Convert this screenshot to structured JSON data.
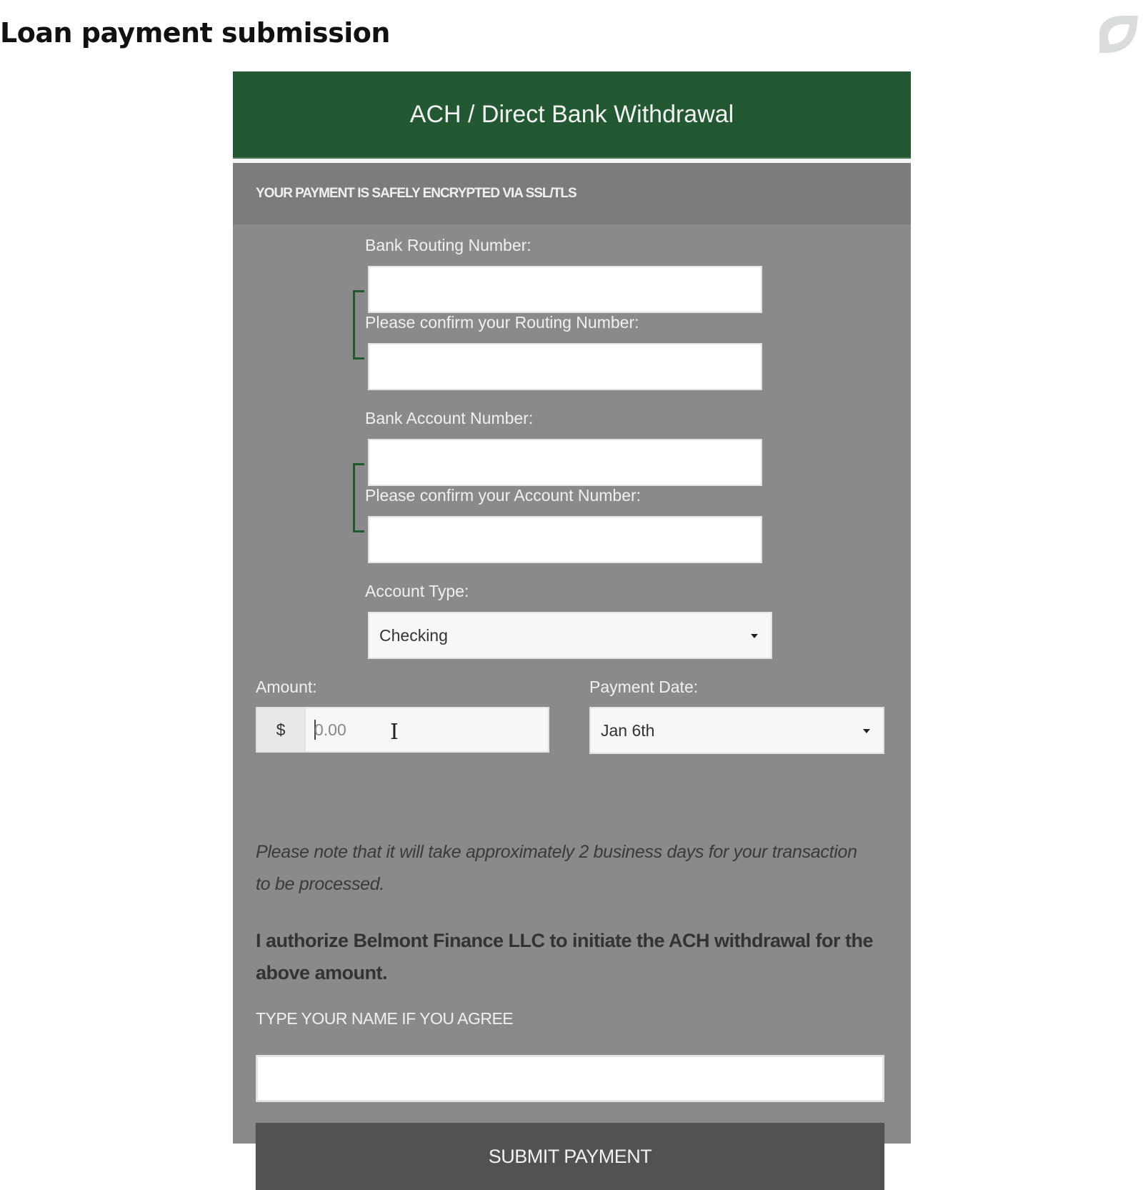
{
  "page": {
    "title": "Loan payment submission",
    "corner_icon": "leaf-logo-icon"
  },
  "form": {
    "header": "ACH / Direct Bank Withdrawal",
    "secure_banner": "YOUR PAYMENT IS SAFELY ENCRYPTED VIA SSL/TLS",
    "routing_label": "Bank Routing Number:",
    "routing_value": "",
    "confirm_routing_label": "Please confirm your Routing Number:",
    "confirm_routing_value": "",
    "account_label": "Bank Account Number:",
    "account_value": "",
    "confirm_account_label": "Please confirm your Account Number:",
    "confirm_account_value": "",
    "account_type_label": "Account Type:",
    "account_type_value": "Checking",
    "amount_label": "Amount:",
    "amount_prefix": "$",
    "amount_placeholder": "0.00",
    "payment_date_label": "Payment Date:",
    "payment_date_value": "Jan 6th",
    "processing_note": "Please note that it will take approximately 2 business days for your transaction to be processed.",
    "authorization_text": "I authorize Belmont Finance LLC to initiate the ACH withdrawal for the above amount.",
    "agree_label": "TYPE YOUR NAME IF YOU AGREE",
    "name_value": "",
    "submit_label": "SUBMIT PAYMENT"
  },
  "colors": {
    "header_green": "#225832",
    "panel_gray": "#8a8a8a",
    "button_dark": "#525252"
  }
}
